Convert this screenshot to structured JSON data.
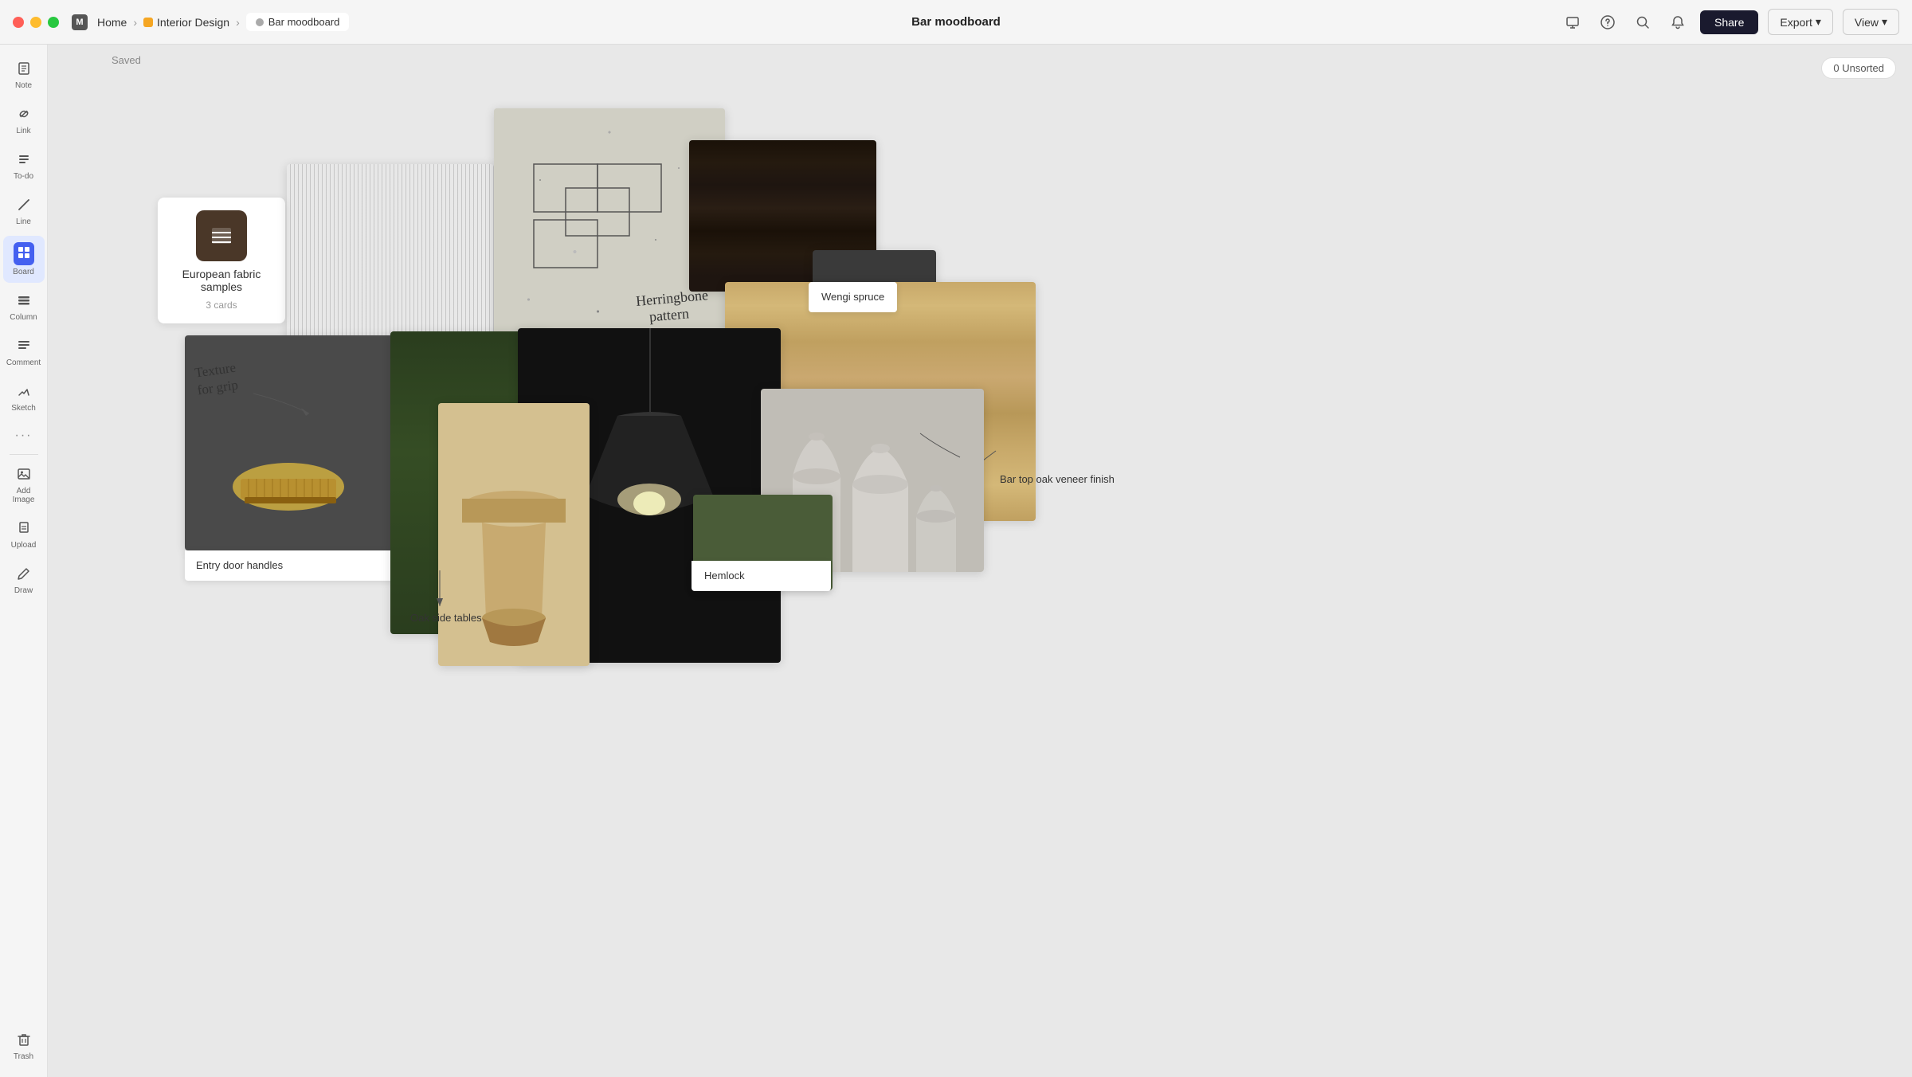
{
  "titlebar": {
    "app_name": "Home",
    "project_name": "Interior Design",
    "tab_name": "Bar moodboard",
    "page_title": "Bar moodboard",
    "saved_label": "Saved"
  },
  "header_actions": {
    "share_label": "Share",
    "export_label": "Export",
    "export_arrow": "▾",
    "view_label": "View",
    "view_arrow": "▾",
    "unsorted_label": "0 Unsorted",
    "notifications_count": "0"
  },
  "sidebar": {
    "items": [
      {
        "id": "note",
        "label": "Note",
        "icon": "☰"
      },
      {
        "id": "link",
        "label": "Link",
        "icon": "🔗"
      },
      {
        "id": "todo",
        "label": "To-do",
        "icon": "≡"
      },
      {
        "id": "line",
        "label": "Line",
        "icon": "╱"
      },
      {
        "id": "board",
        "label": "Board",
        "icon": "⊞",
        "active": true
      },
      {
        "id": "column",
        "label": "Column",
        "icon": "▬"
      },
      {
        "id": "comment",
        "label": "Comment",
        "icon": "≡"
      },
      {
        "id": "sketch",
        "label": "Sketch",
        "icon": "✏"
      },
      {
        "id": "more",
        "label": "",
        "icon": "···"
      },
      {
        "id": "add-image",
        "label": "Add Image",
        "icon": "⊞"
      },
      {
        "id": "upload",
        "label": "Upload",
        "icon": "📄"
      },
      {
        "id": "draw",
        "label": "Draw",
        "icon": "✏"
      }
    ],
    "trash_label": "Trash"
  },
  "moodboard": {
    "items": [
      {
        "id": "european-fabric",
        "title": "European fabric samples",
        "count": "3 cards"
      },
      {
        "id": "stone-pattern",
        "label": "Herringbone pattern"
      },
      {
        "id": "dark-wood",
        "label": ""
      },
      {
        "id": "wengi-spruce",
        "label": "Wengi spruce"
      },
      {
        "id": "oak-veneer",
        "label": ""
      },
      {
        "id": "bar-top-oak",
        "label": "Bar top oak veneer finish"
      },
      {
        "id": "door-handles",
        "label": "Entry door handles",
        "annotation": "Texture for grip"
      },
      {
        "id": "pendant-lamp",
        "label": ""
      },
      {
        "id": "side-tables",
        "label": "Oak side tables"
      },
      {
        "id": "ceramic-vases",
        "label": ""
      },
      {
        "id": "hemlock",
        "label": "Hemlock"
      }
    ]
  }
}
